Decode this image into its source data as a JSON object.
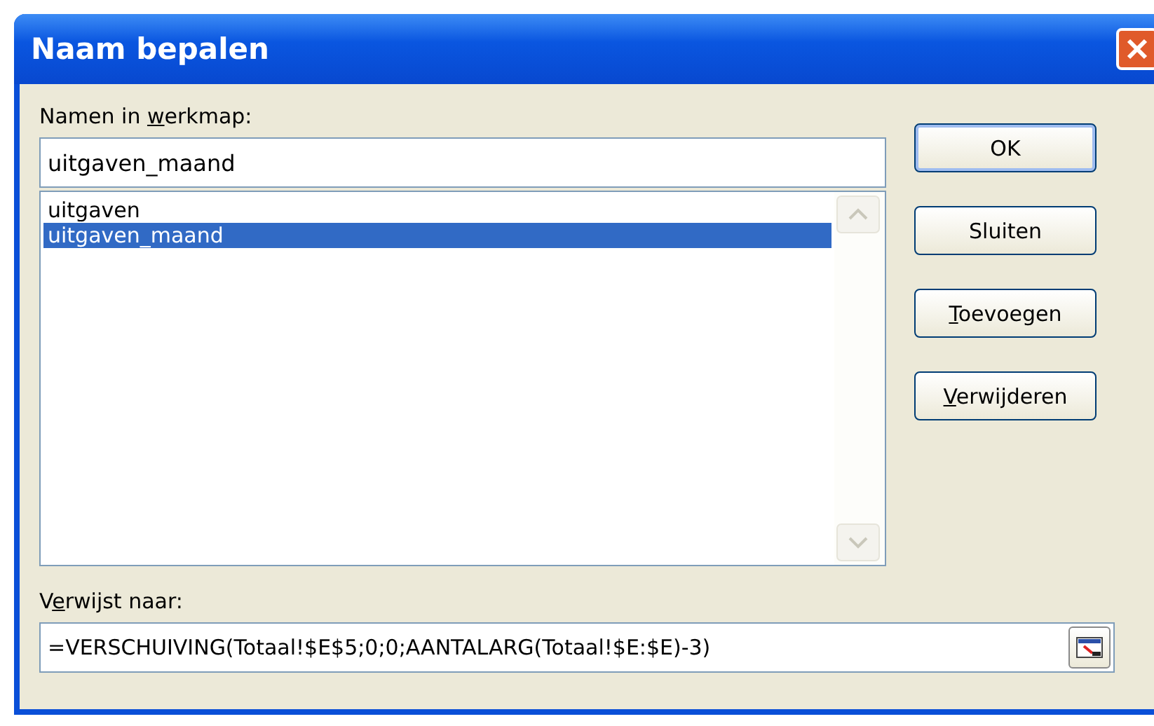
{
  "window": {
    "title": "Naam bepalen"
  },
  "names_label": {
    "pre": "Namen in ",
    "key": "w",
    "post": "erkmap:"
  },
  "name_field": {
    "value": "uitgaven_maand"
  },
  "names_list": [
    {
      "label": "uitgaven",
      "selected": false
    },
    {
      "label": "uitgaven_maand",
      "selected": true
    }
  ],
  "buttons": [
    {
      "post": "OK",
      "default": true
    },
    {
      "post": "Sluiten",
      "default": false
    },
    {
      "key": "T",
      "post": "oevoegen",
      "default": false
    },
    {
      "key": "V",
      "post": "erwijderen",
      "default": false
    }
  ],
  "refers_label": {
    "pre": "V",
    "key": "e",
    "post": "rwijst naar:"
  },
  "refers_field": {
    "value": "=VERSCHUIVING(Totaal!$E$5;0;0;AANTALARG(Totaal!$E:$E)-3)"
  }
}
